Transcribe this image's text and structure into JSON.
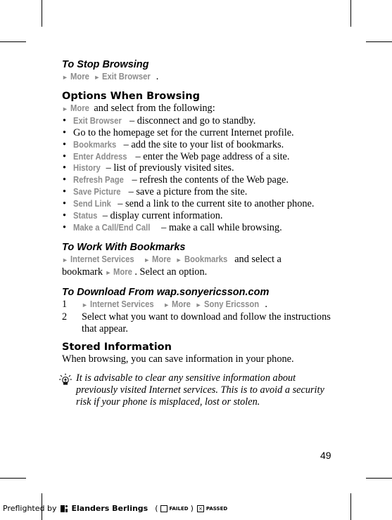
{
  "sections": {
    "stop_browsing": {
      "title": "To Stop Browsing",
      "path": [
        "More",
        "Exit Browser"
      ],
      "suffix": "."
    },
    "options": {
      "title": "Options When Browsing",
      "intro_cmd": "More",
      "intro_text": " and select from the following:",
      "items": [
        {
          "cmd": "Exit Browser",
          "text": " – disconnect and go to standby."
        },
        {
          "cmd": "",
          "text": "Go to the homepage set for the current Internet profile."
        },
        {
          "cmd": "Bookmarks",
          "text": " – add the site to your list of bookmarks."
        },
        {
          "cmd": "Enter Address",
          "text": " – enter the Web page address of a site."
        },
        {
          "cmd": "History",
          "text": " – list of previously visited sites."
        },
        {
          "cmd": "Refresh Page",
          "text": " – refresh the contents of the Web page."
        },
        {
          "cmd": "Save Picture",
          "text": " – save a picture from the site."
        },
        {
          "cmd": "Send Link",
          "text": " – send a link to the current site to another phone."
        },
        {
          "cmd": "Status",
          "text": " – display current information."
        },
        {
          "cmd": "Make a Call/End Call",
          "text": " – make a call while browsing."
        }
      ]
    },
    "bookmarks": {
      "title": "To Work With Bookmarks",
      "path": [
        "Internet Services",
        "More",
        "Bookmarks"
      ],
      "text1": " and select a",
      "text2": "bookmark ",
      "cmd2": "More",
      "text3": ". Select an option."
    },
    "download": {
      "title": "To Download From wap.sonyericsson.com",
      "steps": [
        {
          "num": "1",
          "path": [
            "Internet Services",
            "More",
            "Sony Ericsson"
          ],
          "suffix": "."
        },
        {
          "num": "2",
          "text": "Select what you want to download and follow the instructions that appear."
        }
      ]
    },
    "stored": {
      "title": "Stored Information",
      "text": "When browsing, you can save information in your phone.",
      "tip": "It is advisable to clear any sensitive information about previously visited Internet services. This is to avoid a security risk if your phone is misplaced, lost or stolen."
    }
  },
  "page_number": "49",
  "footer": {
    "preflighted": "Preflighted by",
    "brand": "Elanders Berlings",
    "open_paren": "(",
    "failed": "FAILED",
    "close_paren": ")",
    "passed": "PASSED",
    "passed_mark": "×"
  },
  "arrow_glyph": "►",
  "bullet_glyph": "•"
}
